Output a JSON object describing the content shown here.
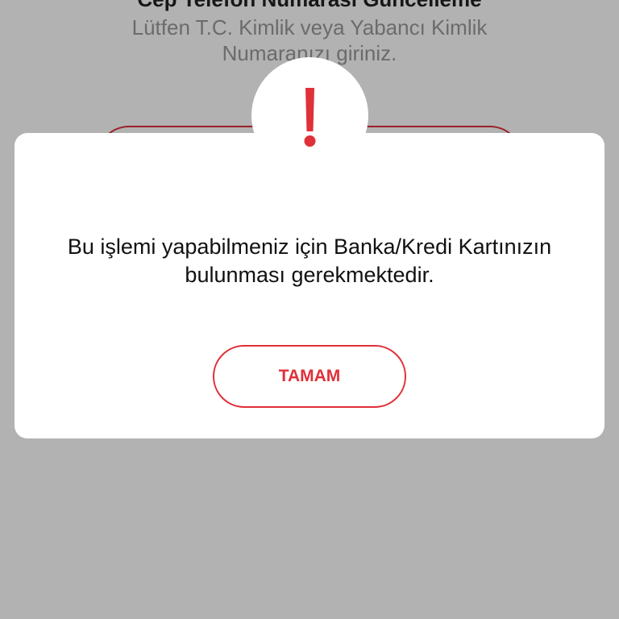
{
  "background_page": {
    "title": "Cep Telefon Numarası Güncelleme",
    "subtitle": "Lütfen T.C. Kimlik veya Yabancı Kimlik Numaranızı giriniz."
  },
  "dialog": {
    "icon": "exclamation-icon",
    "message": "Bu işlemi yapabilmeniz için Banka/Kredi Kartınızın bulunması gerekmektedir.",
    "ok_label": "TAMAM"
  },
  "colors": {
    "accent": "#e0303a",
    "overlay": "#b3b3b3",
    "text": "#111111",
    "muted_text": "#9a9a9a"
  }
}
